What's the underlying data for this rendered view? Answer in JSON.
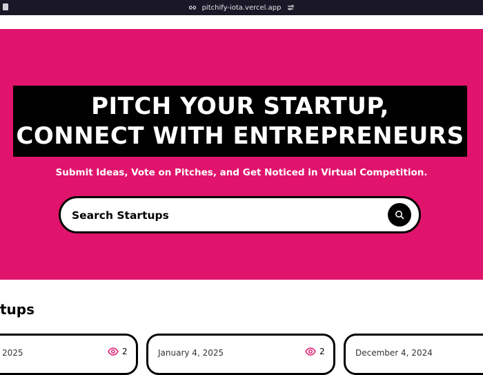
{
  "browser": {
    "url": "pitchify-iota.vercel.app"
  },
  "hero": {
    "heading_line1": "PITCH YOUR STARTUP,",
    "heading_line2": "CONNECT WITH ENTREPRENEURS",
    "subtitle": "Submit Ideas, Vote on Pitches, and Get Noticed in Virtual Competition.",
    "search_placeholder": "Search Startups"
  },
  "section": {
    "title": "tups"
  },
  "cards": [
    {
      "date": "2025",
      "views": "2"
    },
    {
      "date": "January 4, 2025",
      "views": "2"
    },
    {
      "date": "December 4, 2024",
      "views": ""
    }
  ],
  "colors": {
    "accent": "#e0146c",
    "dark": "#000000",
    "eye": "#e0146c"
  }
}
